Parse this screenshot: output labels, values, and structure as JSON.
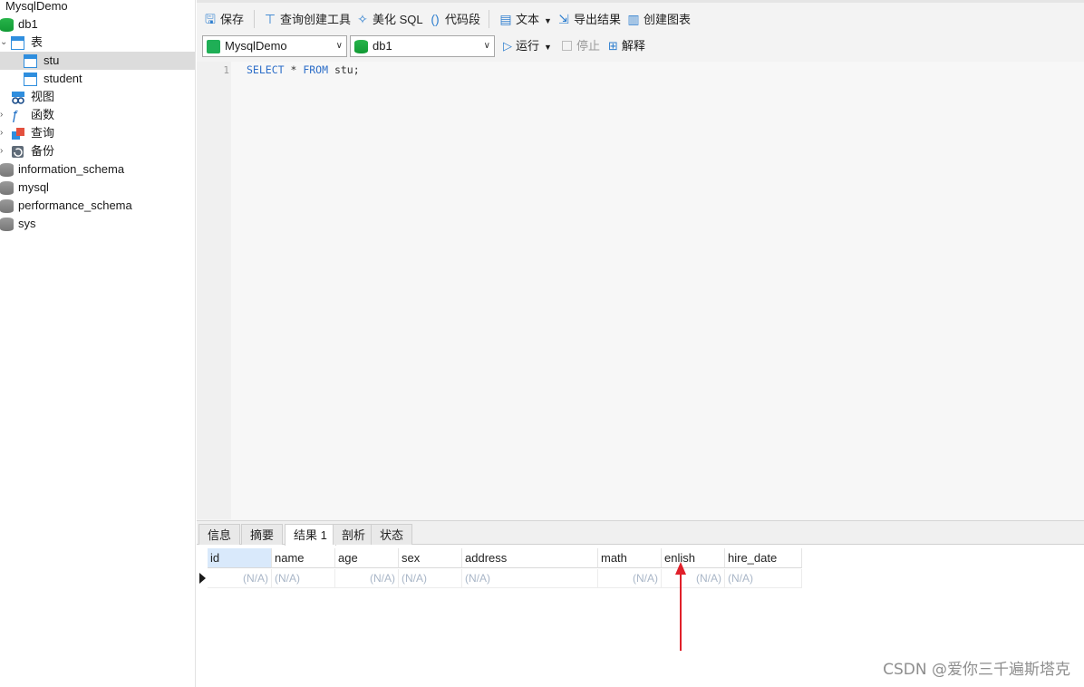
{
  "sidebar": {
    "connection": "MysqlDemo",
    "db": "db1",
    "tables_folder": "表",
    "tables": [
      "stu",
      "student"
    ],
    "views": "视图",
    "functions": "函数",
    "queries": "查询",
    "backups": "备份",
    "other_dbs": [
      "information_schema",
      "mysql",
      "performance_schema",
      "sys"
    ]
  },
  "toolbar": {
    "save": "保存",
    "query_builder": "查询创建工具",
    "beautify": "美化 SQL",
    "snippet": "代码段",
    "text": "文本",
    "export": "导出结果",
    "chart": "创建图表",
    "connection": "MysqlDemo",
    "database": "db1",
    "run": "运行",
    "stop": "停止",
    "explain": "解释"
  },
  "editor": {
    "line": "1",
    "kw_select": "SELECT",
    "star": " * ",
    "kw_from": "FROM",
    "rest": " stu;"
  },
  "result": {
    "tabs": [
      "信息",
      "摘要",
      "结果 1",
      "剖析",
      "状态"
    ],
    "columns": [
      "id",
      "name",
      "age",
      "sex",
      "address",
      "math",
      "enlish",
      "hire_date"
    ],
    "row": [
      "(N/A)",
      "(N/A)",
      "(N/A)",
      "(N/A)",
      "(N/A)",
      "(N/A)",
      "(N/A)",
      "(N/A)"
    ]
  },
  "watermark": "CSDN @爱你三千遍斯塔克",
  "colors": {
    "accent": "#2f7fcf",
    "selection": "#dcdcdc",
    "header_active": "#d9e9fb",
    "annotation": "#e0202a"
  }
}
